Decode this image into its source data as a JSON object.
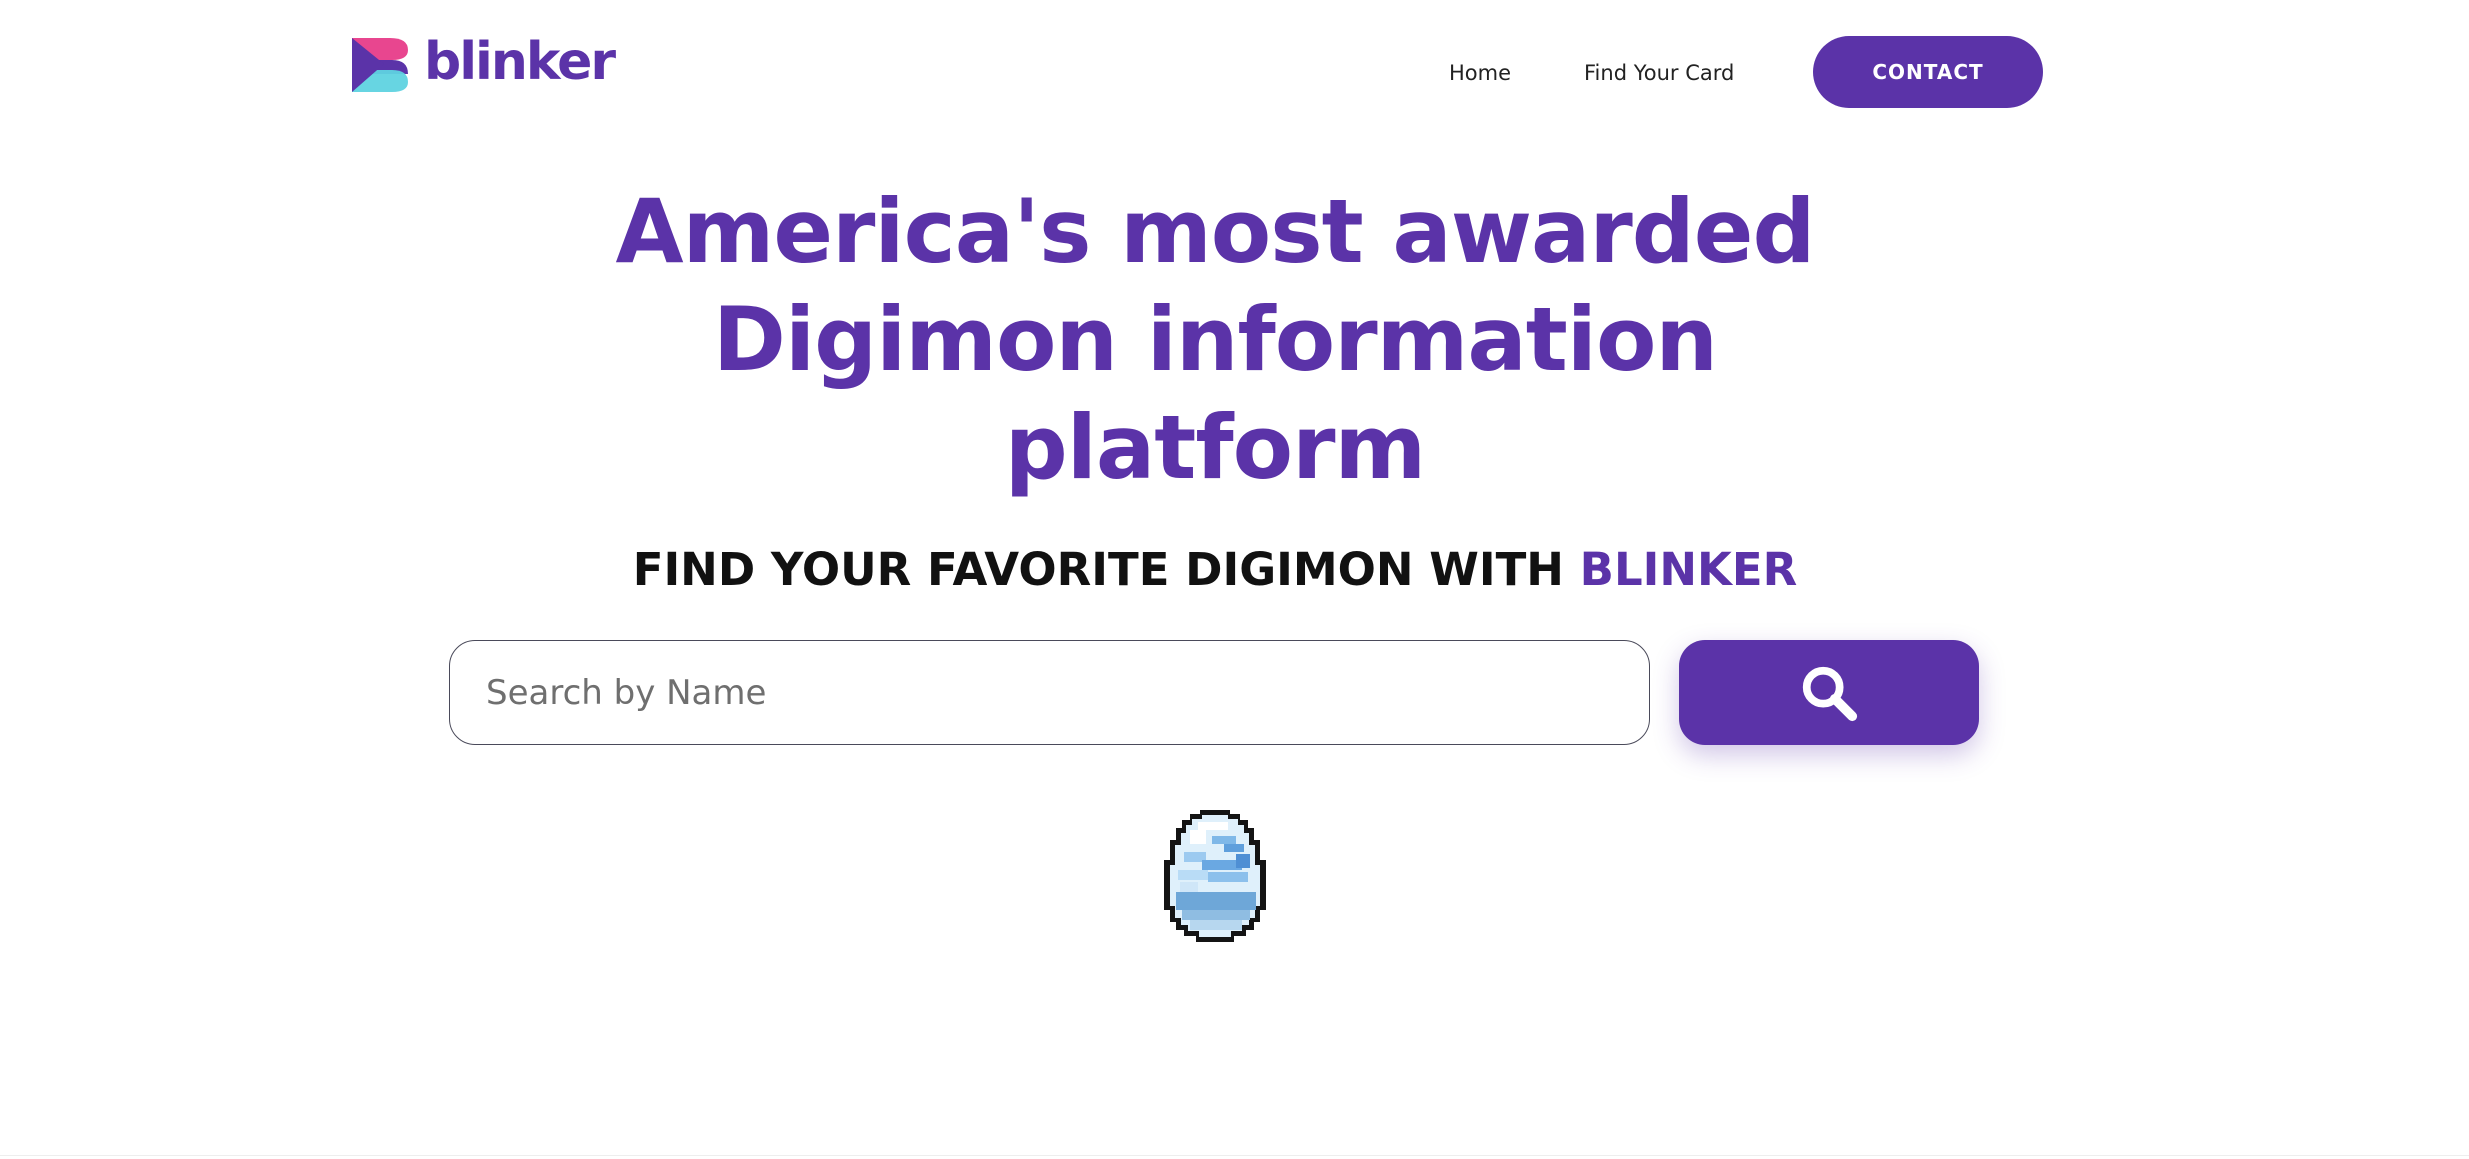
{
  "header": {
    "logo_text": "blinker",
    "nav": {
      "home_label": "Home",
      "find_card_label": "Find Your Card"
    },
    "contact_label": "CONTACT"
  },
  "hero": {
    "title": "America's most awarded Digimon information platform",
    "subtitle_prefix": "FIND YOUR FAVORITE DIGIMON WITH ",
    "subtitle_brand": "BLINKER"
  },
  "search": {
    "placeholder": "Search by Name",
    "value": "",
    "button_icon": "search-icon"
  },
  "colors": {
    "brand_purple": "#5b33a8",
    "logo_pink": "#e8468f",
    "logo_cyan": "#5fd3e0",
    "text_dark": "#111111"
  },
  "egg_icon": "digimon-egg-icon"
}
